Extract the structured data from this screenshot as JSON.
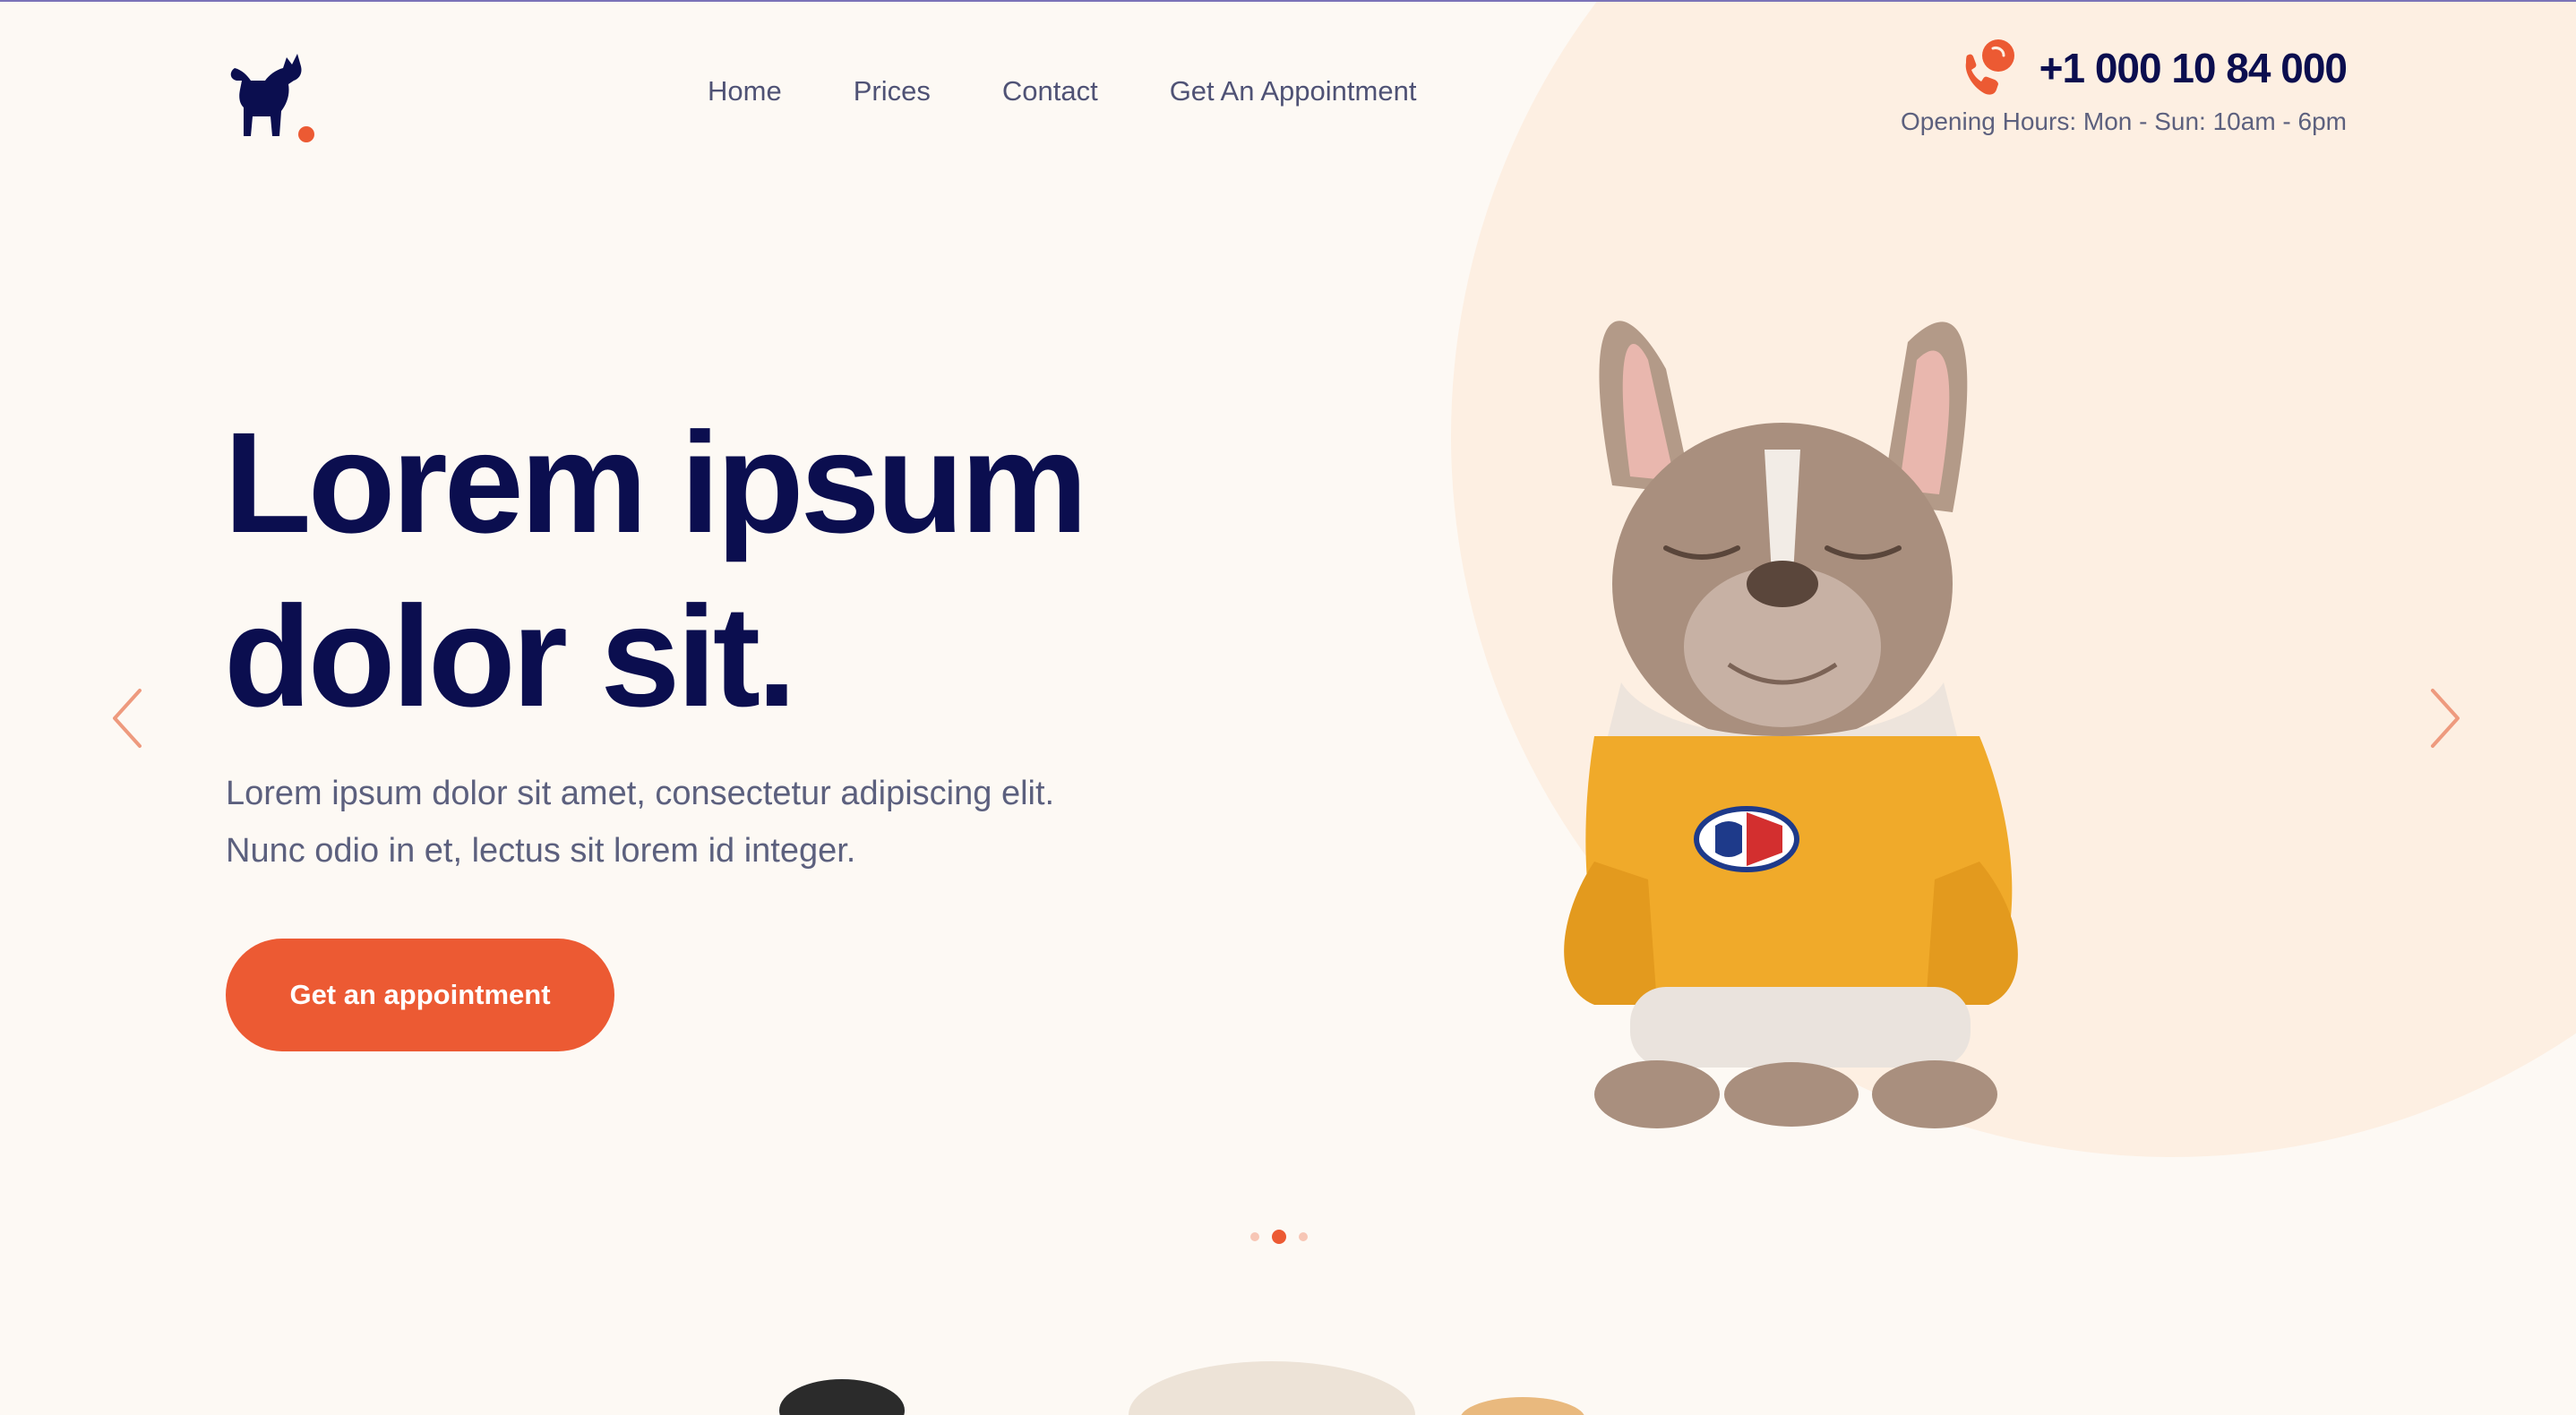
{
  "header": {
    "logo_icon": "dog-icon",
    "nav": {
      "home": "Home",
      "prices": "Prices",
      "contact": "Contact",
      "appointment": "Get An Appointment"
    },
    "phone_icon": "phone-icon",
    "phone": "+1 000 10 84 000",
    "hours": "Opening Hours: Mon - Sun: 10am - 6pm"
  },
  "hero": {
    "title_line1": "Lorem ipsum",
    "title_line2": "dolor sit.",
    "subtitle_line1": "Lorem ipsum dolor sit amet, consectetur adipiscing elit.",
    "subtitle_line2": "Nunc odio in et, lectus sit lorem id integer.",
    "cta": "Get an appointment",
    "prev_icon": "chevron-left-icon",
    "next_icon": "chevron-right-icon",
    "image": "french-bulldog-in-yellow-sweater",
    "slide_count": 3,
    "active_slide": 2
  },
  "colors": {
    "accent": "#EC5A33",
    "navy": "#0B0E4F",
    "text_muted": "#5C607E",
    "background": "#FDF9F4",
    "blob": "#FDEFE2"
  }
}
